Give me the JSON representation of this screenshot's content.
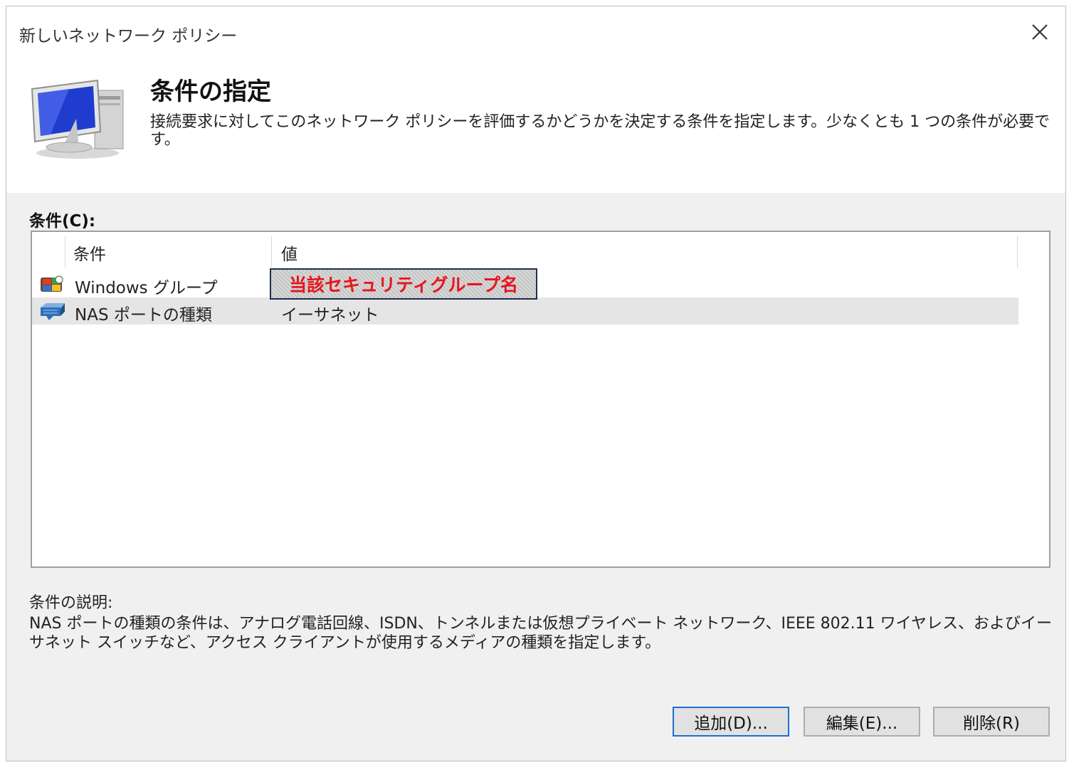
{
  "window": {
    "title": "新しいネットワーク ポリシー"
  },
  "header": {
    "title": "条件の指定",
    "description": "接続要求に対してこのネットワーク ポリシーを評価するかどうかを決定する条件を指定します。少なくとも 1 つの条件が必要です。",
    "icon": "network-policy-computer-icon"
  },
  "conditions": {
    "label": "条件(C):",
    "columns": [
      "条件",
      "値"
    ],
    "rows": [
      {
        "condition": "Windows グループ",
        "value": "当該セキュリティグループ名",
        "icon": "windows-group-icon"
      },
      {
        "condition": "NAS ポートの種類",
        "value": "イーサネット",
        "icon": "nas-port-icon"
      }
    ],
    "selected_row": 1
  },
  "condition_description": {
    "label": "条件の説明:",
    "text": "NAS ポートの種類の条件は、アナログ電話回線、ISDN、トンネルまたは仮想プライベート ネットワーク、IEEE 802.11 ワイヤレス、およびイーサネット スイッチなど、アクセス クライアントが使用するメディアの種類を指定します。"
  },
  "buttons": {
    "add": "追加(D)...",
    "edit": "編集(E)...",
    "remove": "削除(R)"
  },
  "colors": {
    "highlight_text": "#e8141c",
    "primary_button_border": "#1e6fd0"
  }
}
